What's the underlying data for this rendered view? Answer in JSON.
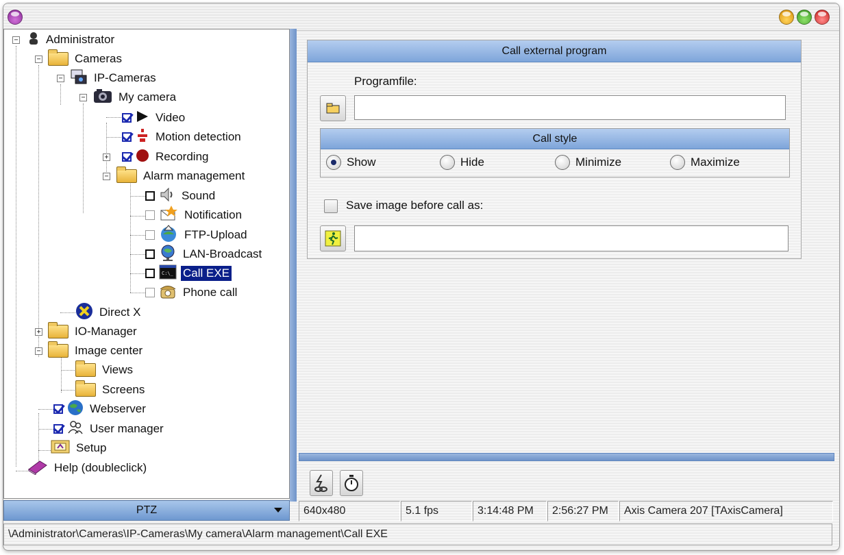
{
  "window": {
    "title": ""
  },
  "tree": {
    "administrator": "Administrator",
    "cameras": "Cameras",
    "ip_cameras": "IP-Cameras",
    "my_camera": "My camera",
    "video": "Video",
    "motion_detection": "Motion detection",
    "recording": "Recording",
    "alarm_management": "Alarm management",
    "sound": "Sound",
    "notification": "Notification",
    "ftp_upload": "FTP-Upload",
    "lan_broadcast": "LAN-Broadcast",
    "call_exe": "Call EXE",
    "phone_call": "Phone call",
    "direct_x": "Direct X",
    "io_manager": "IO-Manager",
    "image_center": "Image center",
    "views": "Views",
    "screens": "Screens",
    "webserver": "Webserver",
    "user_manager": "User manager",
    "setup": "Setup",
    "help": "Help (doubleclick)"
  },
  "ptz": {
    "label": "PTZ"
  },
  "panel": {
    "header": "Call external program",
    "programfile_label": "Programfile:",
    "programfile_value": "",
    "call_style_header": "Call style",
    "call_style_options": [
      "Show",
      "Hide",
      "Minimize",
      "Maximize"
    ],
    "call_style_selected": "Show",
    "save_image_label": "Save image before call as:",
    "save_image_checked": false,
    "save_image_value": ""
  },
  "status": {
    "resolution": "640x480",
    "fps": "5.1 fps",
    "time1": "3:14:48 PM",
    "time2": "2:56:27 PM",
    "camera": "Axis Camera 207 [TAxisCamera]"
  },
  "path": "\\Administrator\\Cameras\\IP-Cameras\\My camera\\Alarm management\\Call EXE",
  "colors": {
    "accent": "#7ea5da",
    "selection": "#0a1f8a"
  }
}
